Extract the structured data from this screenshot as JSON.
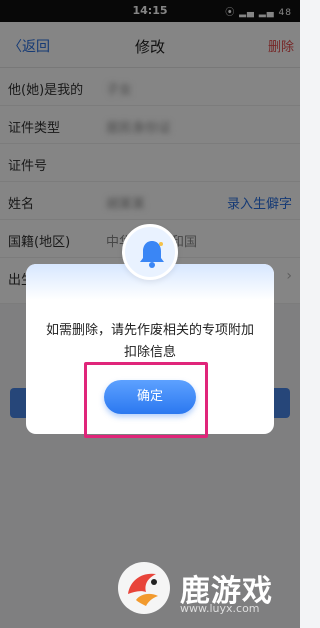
{
  "status_bar": {
    "time": "14:15",
    "icons_text": "⦿ ▂▄ ▂▄ 48"
  },
  "nav": {
    "back_label": "〈返回",
    "title": "修改",
    "delete_label": "删除"
  },
  "form": {
    "rows": [
      {
        "label": "他(她)是我的",
        "value": "子女"
      },
      {
        "label": "证件类型",
        "value": "居民身份证"
      },
      {
        "label": "证件号",
        "value": ""
      },
      {
        "label": "姓名",
        "value": "胡某某",
        "action": "录入生僻字"
      },
      {
        "label": "国籍(地区)",
        "value": "中华人民共和国"
      },
      {
        "label": "出生日期",
        "value": ""
      }
    ]
  },
  "dialog": {
    "icon": "bell-icon",
    "message": "如需删除，请先作废相关的专项附加扣除信息",
    "confirm_label": "确定"
  },
  "watermark": {
    "text": "鹿游戏",
    "url": "www.luyx.com"
  },
  "colors": {
    "accent": "#2b78f0",
    "delete": "#e34b4b",
    "highlight": "#e0257a",
    "overlay": "rgba(0,0,0,0.48)"
  }
}
